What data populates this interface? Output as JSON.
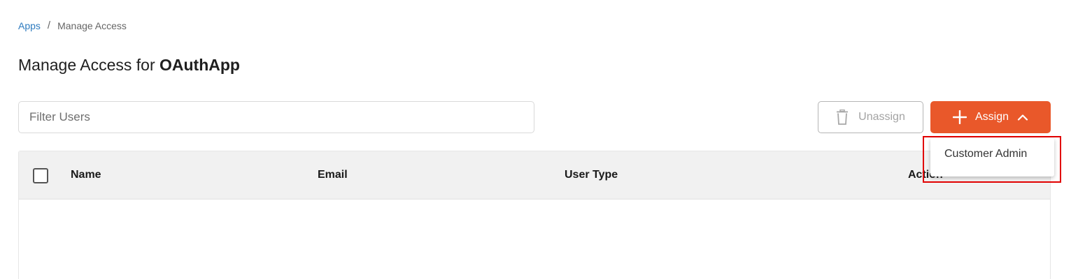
{
  "breadcrumb": {
    "root": "Apps",
    "separator": "/",
    "current": "Manage Access"
  },
  "header": {
    "title_prefix": "Manage Access for",
    "app_name": "OAuthApp"
  },
  "filter": {
    "placeholder": "Filter Users",
    "value": ""
  },
  "toolbar": {
    "unassign_label": "Unassign",
    "assign_label": "Assign"
  },
  "table": {
    "columns": [
      "Name",
      "Email",
      "User Type",
      "Action"
    ],
    "rows": []
  },
  "assign_menu": {
    "expanded": true,
    "items": [
      "Customer Admin"
    ]
  },
  "colors": {
    "accent": "#e9582a",
    "link": "#2e7bbf",
    "highlight": "#e10000"
  },
  "icons": {
    "unassign": "trash-icon",
    "assign": "plus-icon",
    "assign_toggle": "chevron-up-icon"
  }
}
